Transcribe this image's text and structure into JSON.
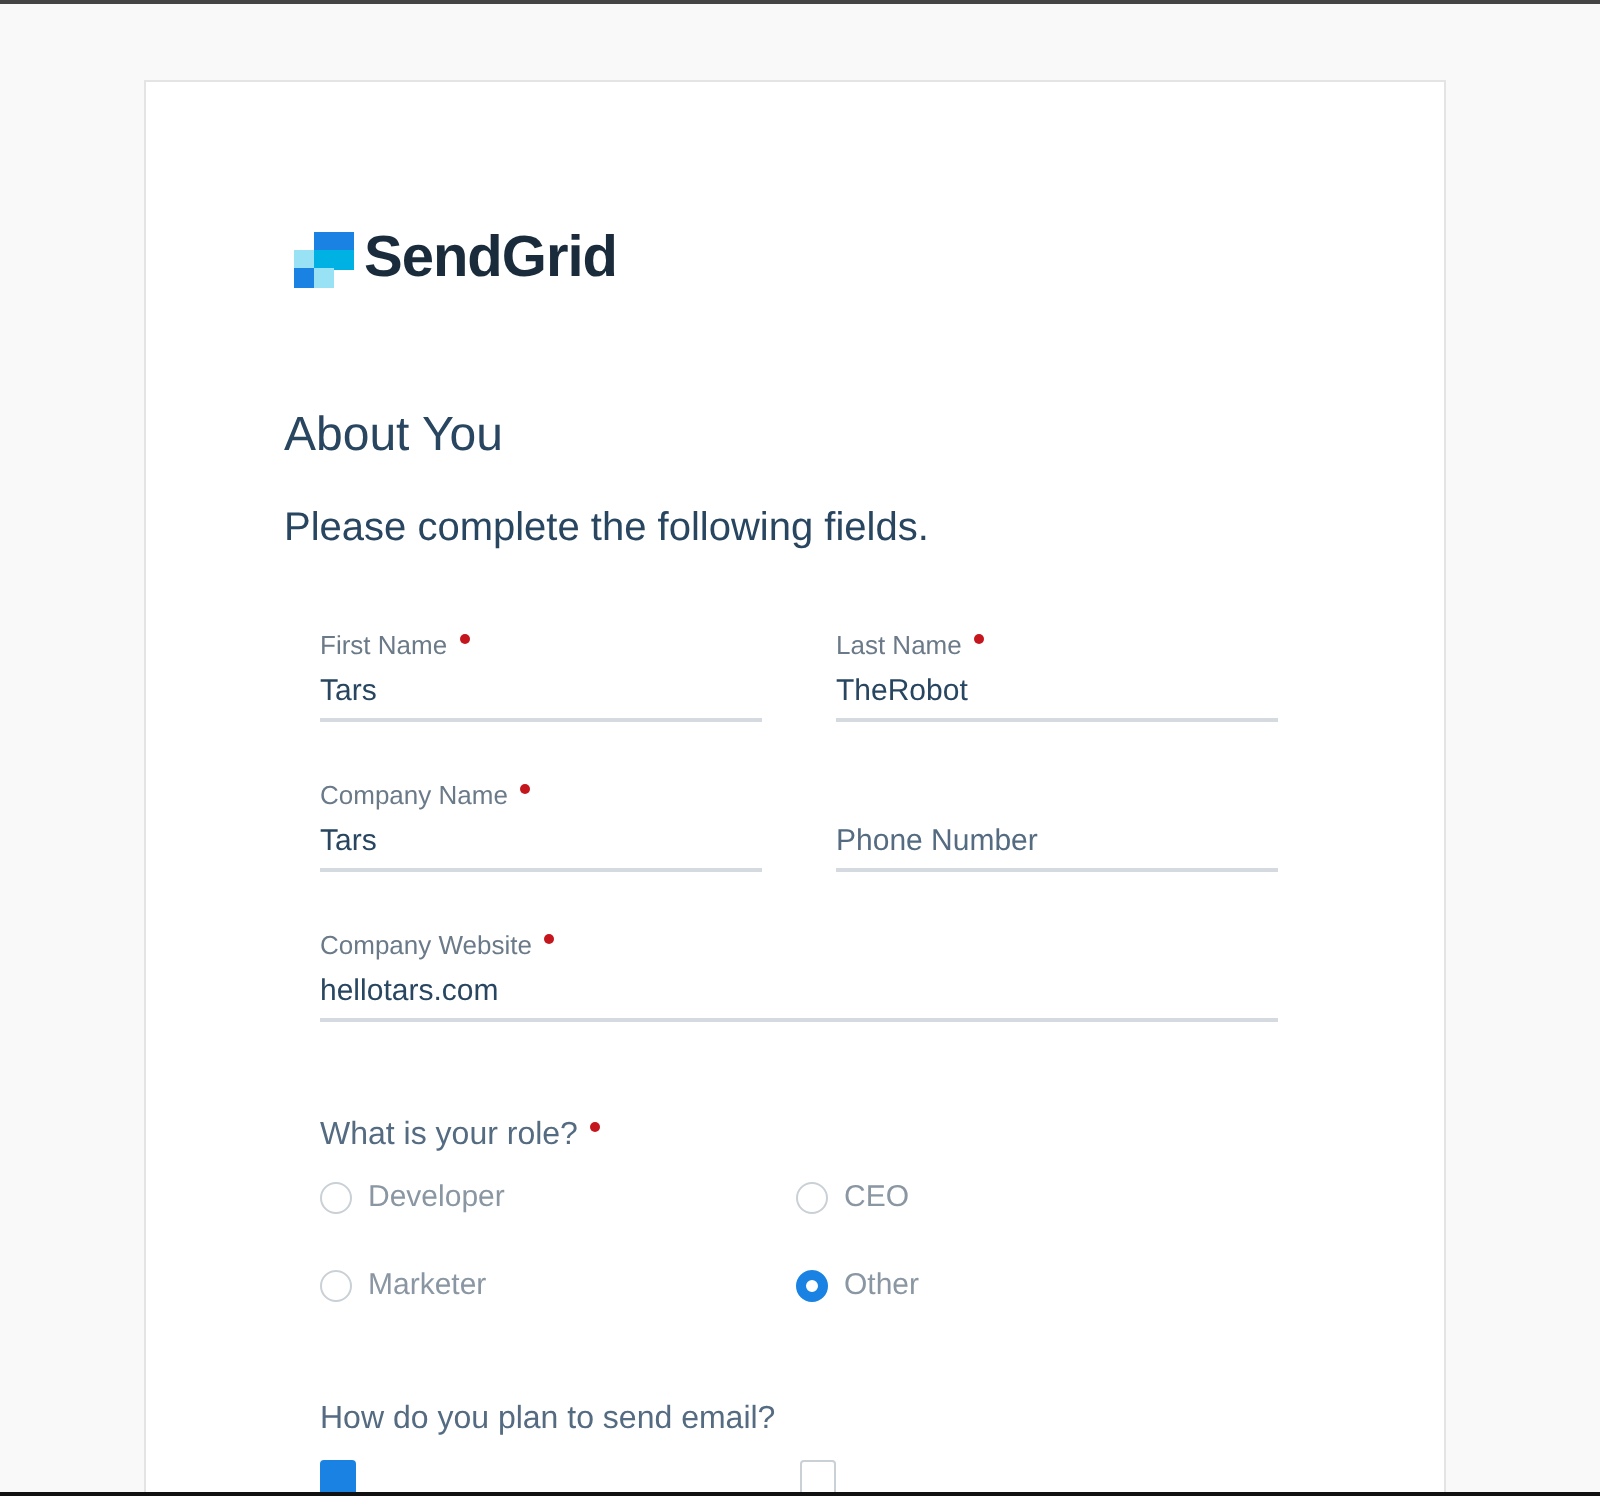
{
  "logo": {
    "text": "SendGrid"
  },
  "heading": "About You",
  "intro": "Please complete the following fields.",
  "fields": [
    {
      "label": "First Name",
      "required": true,
      "value": "Tars"
    },
    {
      "label": "Last Name",
      "required": true,
      "value": "TheRobot"
    },
    {
      "label": "Company Name",
      "required": true,
      "value": "Tars"
    },
    {
      "placeholder": "Phone Number"
    },
    {
      "label": "Company Website",
      "required": true,
      "value": "hellotars.com"
    }
  ],
  "role": {
    "question": "What is your role?",
    "required": true,
    "options": [
      {
        "label": "Developer",
        "selected": false
      },
      {
        "label": "CEO",
        "selected": false
      },
      {
        "label": "Marketer",
        "selected": false
      },
      {
        "label": "Other",
        "selected": true
      }
    ]
  },
  "email_plan": {
    "question": "How do you plan to send email?",
    "options": [
      {
        "checked": true
      },
      {
        "checked": false
      }
    ]
  }
}
